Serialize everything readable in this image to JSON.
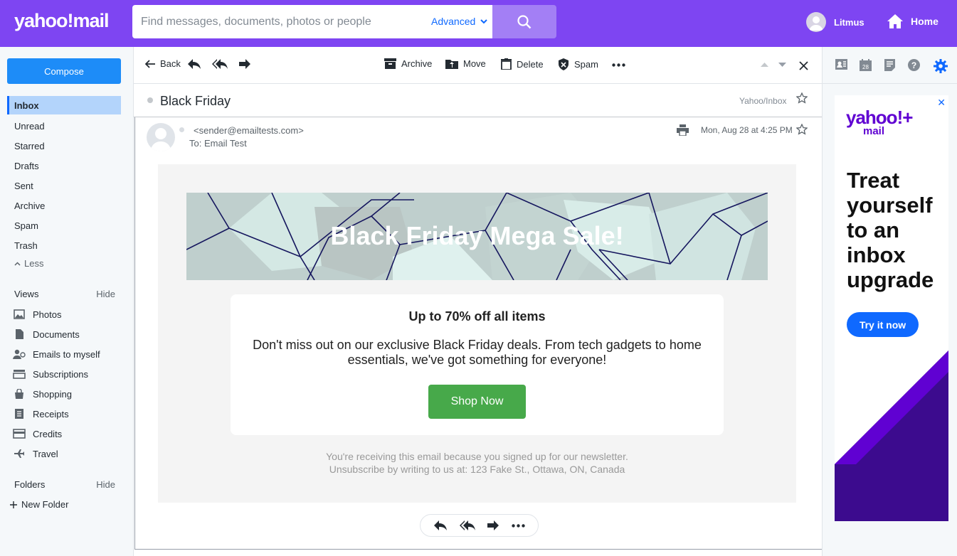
{
  "header": {
    "logo": "yahoo!mail",
    "search_placeholder": "Find messages, documents, photos or people",
    "advanced_label": "Advanced",
    "user_name": "Litmus",
    "home_label": "Home"
  },
  "sidebar": {
    "compose_label": "Compose",
    "folders": [
      "Inbox",
      "Unread",
      "Starred",
      "Drafts",
      "Sent",
      "Archive",
      "Spam",
      "Trash"
    ],
    "active_folder": "Inbox",
    "less_label": "Less",
    "views_label": "Views",
    "views_hide": "Hide",
    "views": [
      {
        "label": "Photos",
        "icon": "photo-icon"
      },
      {
        "label": "Documents",
        "icon": "document-icon"
      },
      {
        "label": "Emails to myself",
        "icon": "person-icon"
      },
      {
        "label": "Subscriptions",
        "icon": "subscriptions-icon"
      },
      {
        "label": "Shopping",
        "icon": "shopping-bag-icon"
      },
      {
        "label": "Receipts",
        "icon": "receipt-icon"
      },
      {
        "label": "Credits",
        "icon": "credit-card-icon"
      },
      {
        "label": "Travel",
        "icon": "plane-icon"
      }
    ],
    "folders_label": "Folders",
    "folders_hide": "Hide",
    "new_folder_label": "New Folder"
  },
  "toolbar": {
    "back_label": "Back",
    "archive_label": "Archive",
    "move_label": "Move",
    "delete_label": "Delete",
    "spam_label": "Spam"
  },
  "message": {
    "subject": "Black Friday",
    "folder_path": "Yahoo/Inbox",
    "sender": "<sender@emailtests.com>",
    "to": "To: Email Test",
    "date": "Mon, Aug 28 at 4:25 PM"
  },
  "email": {
    "hero_title": "Black Friday Mega Sale!",
    "headline": "Up to 70% off all items",
    "body": "Don't miss out on our exclusive Black Friday deals. From tech gadgets to home essentials, we've got something for everyone!",
    "cta_label": "Shop Now",
    "footer_line1": "You're receiving this email because you signed up for our newsletter.",
    "footer_line2": "Unsubscribe by writing to us at: 123 Fake St., Ottawa, ON, Canada"
  },
  "ad": {
    "close_label": "✕",
    "logo": "yahoo!+",
    "logo_sub": "mail",
    "headline": "Treat yourself to an inbox upgrade",
    "cta_label": "Try it now"
  },
  "colors": {
    "header_bg": "#7e45f2",
    "accent": "#0f69ff",
    "cta_green": "#47a94a",
    "ad_purple": "#3c0b8e"
  }
}
